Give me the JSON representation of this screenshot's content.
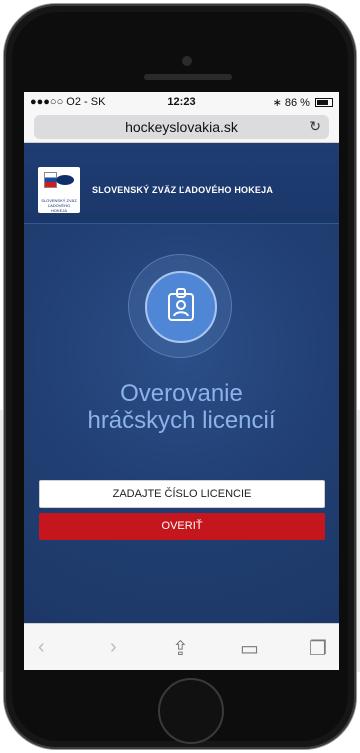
{
  "status_bar": {
    "carrier": "●●●○○ O2 - SK",
    "time": "12:23",
    "battery": "86 %"
  },
  "browser": {
    "url": "hockeyslovakia.sk"
  },
  "site": {
    "org_name": "SLOVENSKÝ ZVÄZ ĽADOVÉHO HOKEJA",
    "logo_text": "SLOVENSKÝ ZVÄZ ĽADOVÉHO HOKEJA"
  },
  "hero": {
    "title_line1": "Overovanie",
    "title_line2": "hráčskych licencií"
  },
  "form": {
    "license_placeholder": "ZADAJTE ČÍSLO LICENCIE",
    "verify_label": "OVERIŤ"
  },
  "toolbar": {
    "back": "back-icon",
    "forward": "forward-icon",
    "share": "share-icon",
    "bookmarks": "bookmarks-icon",
    "tabs": "tabs-icon"
  },
  "colors": {
    "accent_red": "#c4161c",
    "brand_blue": "#1f3e72",
    "badge_blue": "#4f86d6"
  }
}
